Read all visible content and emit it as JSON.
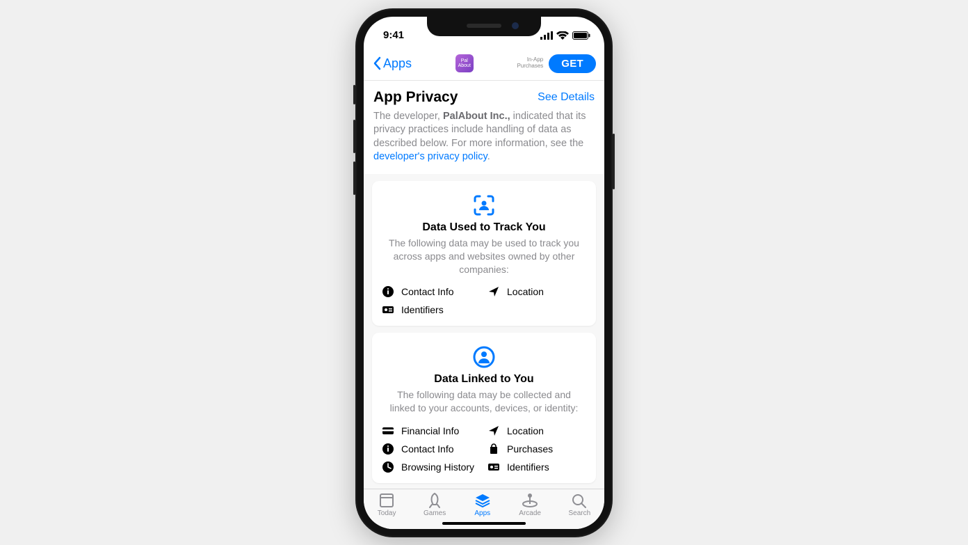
{
  "status": {
    "time": "9:41"
  },
  "nav": {
    "back_label": "Apps",
    "app_icon_text": "Pal About",
    "iap_line1": "In-App",
    "iap_line2": "Purchases",
    "get_label": "GET"
  },
  "header": {
    "title": "App Privacy",
    "see_details": "See Details",
    "desc_prefix": "The developer, ",
    "developer_name": "PalAbout Inc.,",
    "desc_mid": " indicated that its privacy practices include handling of data as described below. For more information, see the ",
    "policy_link": "developer's privacy policy",
    "period": "."
  },
  "cards": [
    {
      "title": "Data Used to Track You",
      "sub": "The following data may be used to track you across apps and websites owned by other companies:",
      "items": [
        {
          "icon": "contact",
          "label": "Contact Info"
        },
        {
          "icon": "location",
          "label": "Location"
        },
        {
          "icon": "identifiers",
          "label": "Identifiers"
        }
      ]
    },
    {
      "title": "Data Linked to You",
      "sub": "The following data may be collected and linked to your accounts, devices, or identity:",
      "items": [
        {
          "icon": "financial",
          "label": "Financial Info"
        },
        {
          "icon": "location",
          "label": "Location"
        },
        {
          "icon": "contact",
          "label": "Contact Info"
        },
        {
          "icon": "purchases",
          "label": "Purchases"
        },
        {
          "icon": "browsing",
          "label": "Browsing History"
        },
        {
          "icon": "identifiers",
          "label": "Identifiers"
        }
      ]
    }
  ],
  "tabs": [
    {
      "label": "Today"
    },
    {
      "label": "Games"
    },
    {
      "label": "Apps"
    },
    {
      "label": "Arcade"
    },
    {
      "label": "Search"
    }
  ],
  "active_tab": 2
}
